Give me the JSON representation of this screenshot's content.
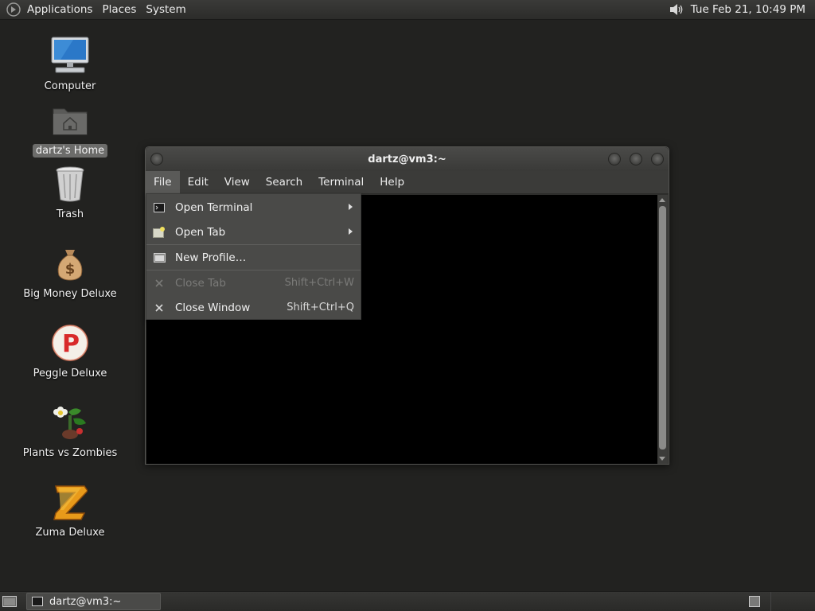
{
  "top_panel": {
    "menus": [
      "Applications",
      "Places",
      "System"
    ],
    "clock": "Tue Feb 21, 10:49 PM",
    "logo_icon": "gnome-foot-icon",
    "volume_icon": "speaker-icon"
  },
  "desktop_icons": [
    {
      "label": "Computer",
      "icon": "computer-icon"
    },
    {
      "label": "dartz's Home",
      "icon": "home-folder-icon",
      "selected": true
    },
    {
      "label": "Trash",
      "icon": "trash-icon"
    },
    {
      "label": "Big Money Deluxe",
      "icon": "money-bag-icon"
    },
    {
      "label": "Peggle Deluxe",
      "icon": "peggle-icon"
    },
    {
      "label": "Plants vs Zombies",
      "icon": "plants-icon"
    },
    {
      "label": "Zuma Deluxe",
      "icon": "zuma-icon"
    }
  ],
  "window": {
    "title": "dartz@vm3:~",
    "menubar": [
      "File",
      "Edit",
      "View",
      "Search",
      "Terminal",
      "Help"
    ],
    "active_menu": "File"
  },
  "file_menu": {
    "items": [
      {
        "label": "Open Terminal",
        "icon": "terminal-icon",
        "submenu": true,
        "enabled": true
      },
      {
        "label": "Open Tab",
        "icon": "new-tab-icon",
        "submenu": true,
        "enabled": true
      },
      {
        "label": "New Profile…",
        "icon": "profile-icon",
        "enabled": true
      },
      {
        "label": "Close Tab",
        "icon": "close-icon",
        "accel": "Shift+Ctrl+W",
        "enabled": false
      },
      {
        "label": "Close Window",
        "icon": "close-icon",
        "accel": "Shift+Ctrl+Q",
        "enabled": true
      }
    ]
  },
  "bottom_panel": {
    "task_label": "dartz@vm3:~",
    "show_desktop_icon": "show-desktop-icon",
    "workspace_icon": "workspace-switcher-icon"
  },
  "colors": {
    "desktop_bg": "#222220",
    "panel_bg": "#2e2e2c",
    "menu_bg": "#4a4a48",
    "terminal_bg": "#000000"
  }
}
